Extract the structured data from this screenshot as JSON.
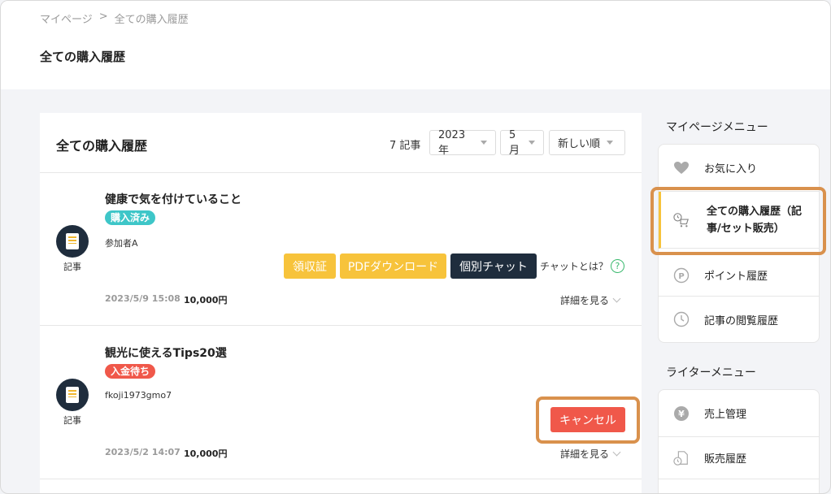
{
  "breadcrumb": {
    "home": "マイページ",
    "sep": ">",
    "current": "全ての購入履歴"
  },
  "page_title": "全ての購入履歴",
  "main": {
    "title": "全ての購入履歴",
    "count": "7 記事",
    "filters": {
      "year": "2023年",
      "month": "5月",
      "sort": "新しい順"
    }
  },
  "items": [
    {
      "title": "健康で気を付けていること",
      "badge": "購入済み",
      "user": "参加者A",
      "type_label": "記事",
      "buttons": {
        "receipt": "領収証",
        "pdf": "PDFダウンロード",
        "chat": "個別チャット"
      },
      "chat_help": "チャットとは？",
      "date": "2023/5/9 15:08",
      "price": "10,000円",
      "detail": "詳細を見る"
    },
    {
      "title": "観光に使えるTips20選",
      "badge": "入金待ち",
      "user": "fkoji1973gmo7",
      "type_label": "記事",
      "buttons": {
        "cancel": "キャンセル"
      },
      "date": "2023/5/2 14:07",
      "price": "10,000円",
      "detail": "詳細を見る"
    }
  ],
  "sidebar": {
    "mypage_heading": "マイページメニュー",
    "mypage_items": [
      {
        "label": "お気に入り",
        "icon": "heart-icon"
      },
      {
        "label_line1": "全ての購入履歴（記",
        "label_line2": "事/セット販売）",
        "icon": "cart-icon"
      },
      {
        "label": "ポイント履歴",
        "icon": "point-icon"
      },
      {
        "label": "記事の閲覧履歴",
        "icon": "clock-icon"
      }
    ],
    "writer_heading": "ライターメニュー",
    "writer_items": [
      {
        "label": "売上管理",
        "icon": "yen-icon"
      },
      {
        "label": "販売履歴",
        "icon": "sales-history-icon"
      }
    ]
  },
  "colors": {
    "accent_yellow": "#f7c33b",
    "navy": "#1f2d3d",
    "teal": "#3ec6c8",
    "red": "#f0584a",
    "highlight": "#d9914d"
  }
}
